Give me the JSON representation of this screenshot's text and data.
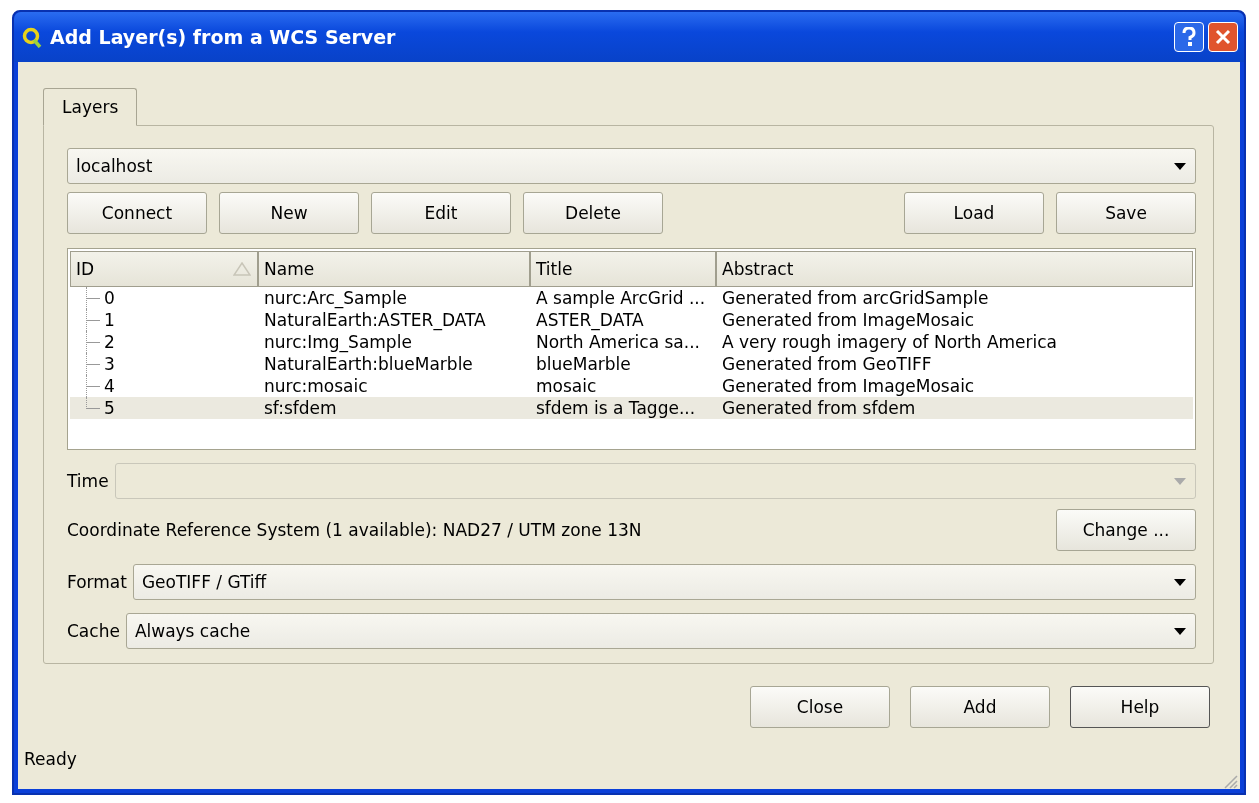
{
  "window": {
    "title": "Add Layer(s) from a WCS Server"
  },
  "tabs": [
    {
      "label": "Layers",
      "selected": true
    }
  ],
  "server": {
    "value": "localhost"
  },
  "server_buttons_left": [
    "Connect",
    "New",
    "Edit",
    "Delete"
  ],
  "server_buttons_right": [
    "Load",
    "Save"
  ],
  "table": {
    "columns": [
      "ID",
      "Name",
      "Title",
      "Abstract"
    ],
    "rows": [
      {
        "cells": [
          "0",
          "nurc:Arc_Sample",
          "A sample ArcGrid ...",
          "Generated from arcGridSample"
        ],
        "selected": false
      },
      {
        "cells": [
          "1",
          "NaturalEarth:ASTER_DATA",
          "ASTER_DATA",
          "Generated from ImageMosaic"
        ],
        "selected": false
      },
      {
        "cells": [
          "2",
          "nurc:Img_Sample",
          "North America sa...",
          "A very rough imagery of North America"
        ],
        "selected": false
      },
      {
        "cells": [
          "3",
          "NaturalEarth:blueMarble",
          "blueMarble",
          "Generated from GeoTIFF"
        ],
        "selected": false
      },
      {
        "cells": [
          "4",
          "nurc:mosaic",
          "mosaic",
          "Generated from ImageMosaic"
        ],
        "selected": false
      },
      {
        "cells": [
          "5",
          "sf:sfdem",
          "sfdem is a Tagge...",
          "Generated from sfdem"
        ],
        "selected": true
      }
    ]
  },
  "time": {
    "label": "Time",
    "disabled": true
  },
  "crs": {
    "text": "Coordinate Reference System (1 available):  NAD27 / UTM zone 13N",
    "button": "Change ..."
  },
  "format": {
    "label": "Format",
    "value": "GeoTIFF / GTiff"
  },
  "cache": {
    "label": "Cache",
    "value": "Always cache"
  },
  "buttons": [
    {
      "label": "Close",
      "kind": "normal"
    },
    {
      "label": "Add",
      "kind": "normal"
    },
    {
      "label": "Help",
      "kind": "default"
    }
  ],
  "status_bar": "Ready"
}
